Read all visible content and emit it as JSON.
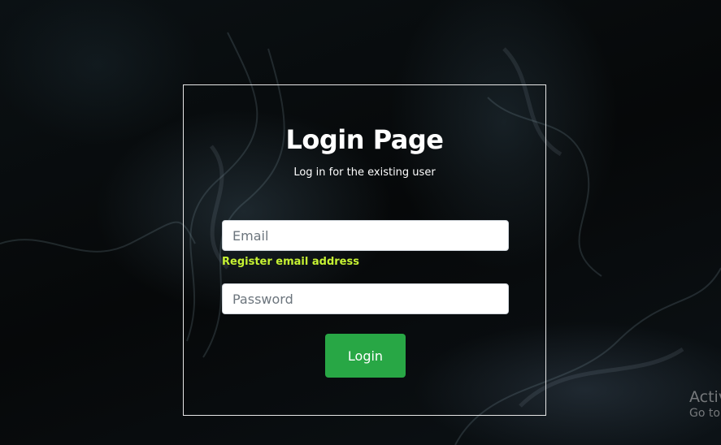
{
  "login": {
    "title": "Login Page",
    "subtitle": "Log in for the existing user",
    "email_placeholder": "Email",
    "email_value": "",
    "email_hint": "Register email address",
    "password_placeholder": "Password",
    "password_value": "",
    "submit_label": "Login"
  },
  "watermark": {
    "title": "Activ",
    "subtitle": "Go to"
  },
  "colors": {
    "accent_button": "#28a745",
    "hint_text": "#c6f233",
    "card_border": "#e6e6e6"
  }
}
